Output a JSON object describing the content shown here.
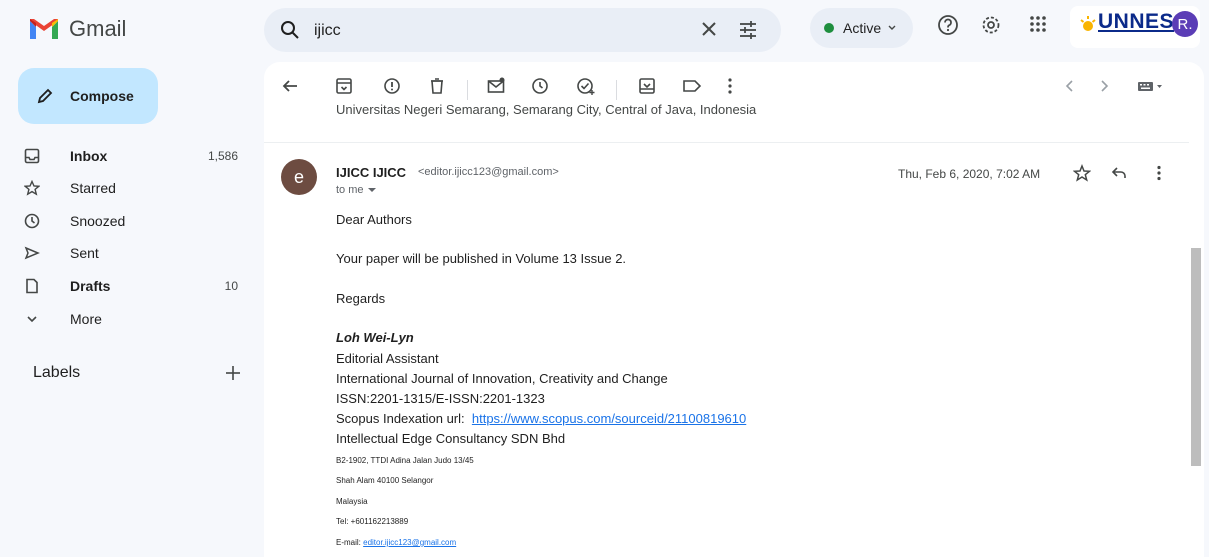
{
  "app": {
    "name": "Gmail"
  },
  "search": {
    "value": "ijicc"
  },
  "status": {
    "label": "Active",
    "color": "#1e8e3e"
  },
  "brand": {
    "text": "UNNES"
  },
  "avatar": {
    "initial": "R."
  },
  "compose": {
    "label": "Compose"
  },
  "sidebar": {
    "items": [
      {
        "label": "Inbox",
        "count": "1,586",
        "icon": "inbox-icon"
      },
      {
        "label": "Starred",
        "count": "",
        "icon": "star-icon"
      },
      {
        "label": "Snoozed",
        "count": "",
        "icon": "clock-icon"
      },
      {
        "label": "Sent",
        "count": "",
        "icon": "send-icon"
      },
      {
        "label": "Drafts",
        "count": "10",
        "icon": "draft-icon"
      },
      {
        "label": "More",
        "count": "",
        "icon": "chevron-down-icon"
      }
    ],
    "labels_heading": "Labels"
  },
  "email": {
    "prev_message_text": "Universitas Negeri Semarang, Semarang City, Central of Java, Indonesia",
    "sender_initial": "e",
    "sender_name": "IJICC IJICC",
    "sender_email": "<editor.ijicc123@gmail.com>",
    "to": "to me",
    "date": "Thu, Feb 6, 2020, 7:02 AM",
    "greeting": "Dear Authors",
    "body": "Your paper will be published in Volume 13 Issue 2.",
    "closing": "Regards",
    "signature": {
      "name": "Loh Wei-Lyn",
      "title": "Editorial Assistant",
      "journal": "International Journal of Innovation, Creativity and Change",
      "issn": "ISSN:2201-1315/E-ISSN:2201-1323",
      "scopus_label": "Scopus Indexation url:",
      "scopus_url": "https://www.scopus.com/sourceid/21100819610",
      "company": "Intellectual Edge Consultancy SDN Bhd",
      "address1": "B2-1902, TTDI Adina Jalan Judo 13/45",
      "address2": "Shah Alam 40100 Selangor",
      "country": "Malaysia",
      "tel": "Tel: +601162213889",
      "email_label": "E-mail:",
      "email_value": "editor.ijicc123@gmail.com"
    }
  }
}
